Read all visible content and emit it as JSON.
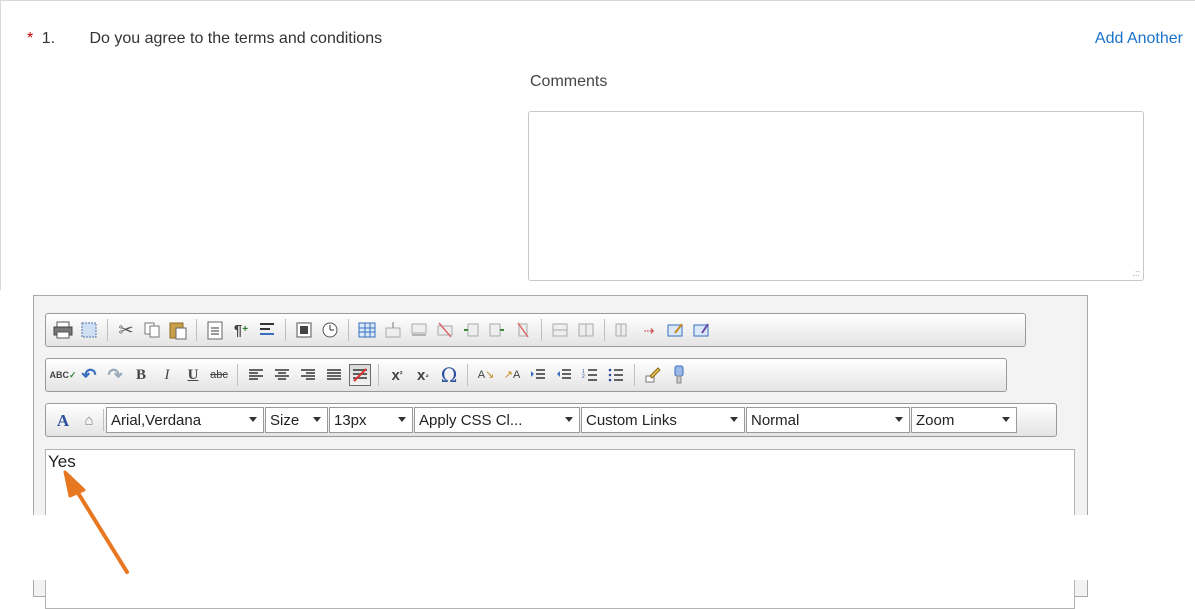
{
  "question": {
    "required_marker": "*",
    "number": "1.",
    "text": "Do you agree to the terms and conditions",
    "add_another_label": "Add Another",
    "comments_label": "Comments",
    "comments_value": ""
  },
  "editor": {
    "toolbar1_icons": [
      "print-icon",
      "select-all-icon",
      "cut-icon",
      "copy-icon",
      "paste-icon",
      "paste-text-icon",
      "paste-word-icon",
      "paragraph-icon",
      "insert-date-icon",
      "insert-time-icon",
      "insert-table-icon",
      "table-row-before-icon",
      "table-row-after-icon",
      "delete-row-icon",
      "column-before-icon",
      "column-after-icon",
      "delete-column-icon",
      "split-cells-icon",
      "merge-cells-icon",
      "table-props-icon",
      "cell-props-icon",
      "row-props-icon",
      "edit-table-icon"
    ],
    "toolbar2_icons": [
      "spellcheck-icon",
      "undo-icon",
      "redo-icon",
      "bold-icon",
      "italic-icon",
      "underline-icon",
      "strikethrough-icon",
      "align-left-icon",
      "align-center-icon",
      "align-right-icon",
      "justify-icon",
      "clear-format-icon",
      "superscript-icon",
      "subscript-icon",
      "special-char-icon",
      "convert-lower-icon",
      "convert-upper-icon",
      "indent-icon",
      "outdent-icon",
      "ordered-list-icon",
      "unordered-list-icon",
      "format-painter-icon",
      "cleanup-icon"
    ],
    "font_family": "Arial,Verdana",
    "font_size_label": "Size",
    "font_size_px": "13px",
    "css_class": "Apply CSS Cl...",
    "custom_links": "Custom Links",
    "paragraph_style": "Normal",
    "zoom": "Zoom",
    "content": "Yes",
    "accent_colors": {
      "link": "#1a73c9",
      "required": "#cc0000",
      "arrow": "#e87722"
    }
  }
}
